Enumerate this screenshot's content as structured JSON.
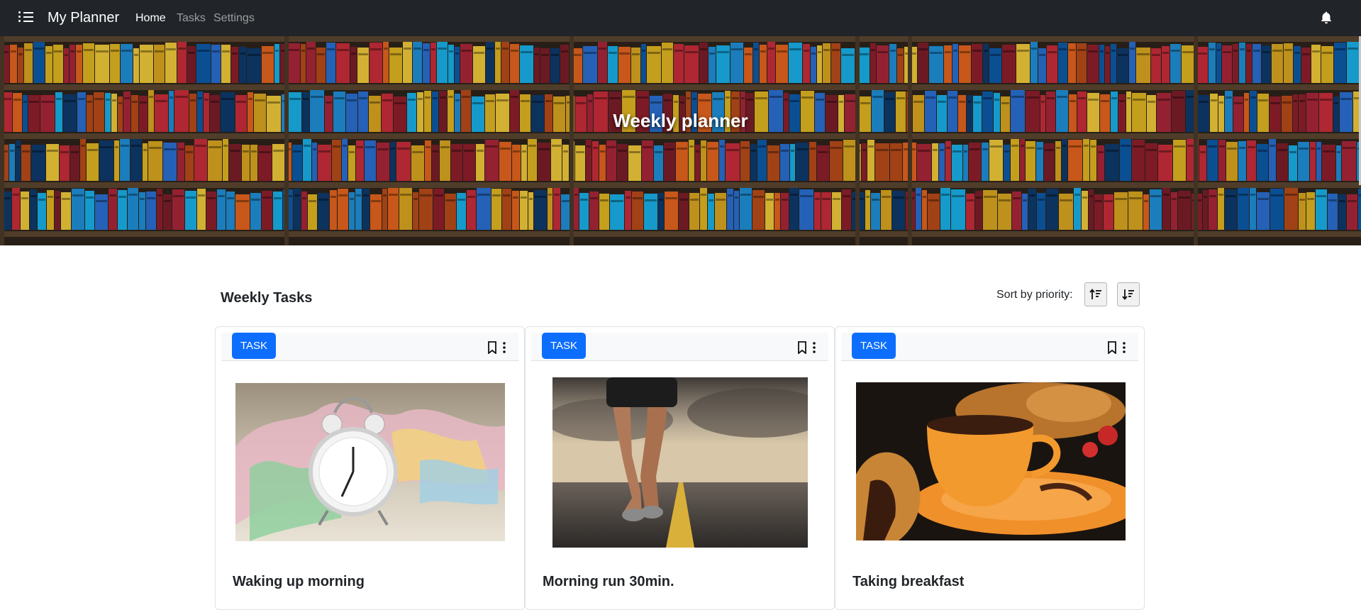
{
  "navbar": {
    "brand": "My Planner",
    "links": [
      {
        "label": "Home",
        "active": true
      },
      {
        "label": "Tasks",
        "active": false
      },
      {
        "label": "Settings",
        "active": false
      }
    ],
    "menu_icon": "list-icon",
    "notification_icon": "bell-icon"
  },
  "hero": {
    "title": "Weekly planner"
  },
  "section": {
    "title": "Weekly Tasks",
    "sort_label": "Sort by priority:",
    "sort_buttons": [
      "sort-ascending-icon",
      "sort-descending-icon"
    ]
  },
  "cards": [
    {
      "badge": "TASK",
      "title": "Waking up morning",
      "image": "alarm-clock-photo"
    },
    {
      "badge": "TASK",
      "title": "Morning run 30min.",
      "image": "runner-on-road-photo"
    },
    {
      "badge": "TASK",
      "title": "Taking breakfast",
      "image": "coffee-and-croissant-photo"
    }
  ],
  "colors": {
    "navbar_bg": "#212529",
    "primary": "#0d6efd",
    "card_header_bg": "#f8f9fa"
  }
}
